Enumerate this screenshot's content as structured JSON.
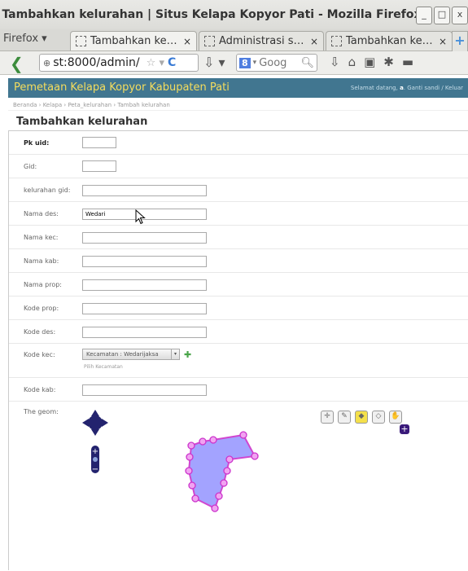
{
  "window": {
    "title": "Tambahkan kelurahan | Situs Kelapa Kopyor Pati - Mozilla Firefox",
    "buttons": [
      "_",
      "□",
      "x"
    ]
  },
  "tabbar": {
    "menu_label": "Firefox ▾",
    "tabs": [
      {
        "label": "Tambahkan ke…",
        "active": true
      },
      {
        "label": "Administrasi s…",
        "active": false
      },
      {
        "label": "Tambahkan ke…",
        "active": false
      }
    ],
    "close_glyph": "×",
    "new_tab_glyph": "+"
  },
  "navbar": {
    "back_glyph": "❮",
    "url_prefix": "st:8000/admin/",
    "search_engine": "8",
    "search_placeholder": "Goog",
    "search_icon": "magnifier-icon",
    "toolbar_icons": [
      "download-arrow-icon",
      "home-icon",
      "addon-icon",
      "bug-icon",
      "folder-icon"
    ]
  },
  "header": {
    "brand": "Pemetaan Kelapa Kopyor Kabupaten Pati",
    "welcome": "Selamat datang, ",
    "username": "a",
    "links": ". Ganti sandi / Keluar"
  },
  "breadcrumbs": "Beranda › Kelapa › Peta_kelurahan › Tambah kelurahan",
  "page_title": "Tambahkan kelurahan",
  "form": {
    "fields": [
      {
        "label": "Pk uid:",
        "value": "",
        "required": true
      },
      {
        "label": "Gid:",
        "value": ""
      },
      {
        "label": "kelurahan gid:",
        "value": ""
      },
      {
        "label": "Nama des:",
        "value": "Wedari"
      },
      {
        "label": "Nama kec:",
        "value": ""
      },
      {
        "label": "Nama kab:",
        "value": ""
      },
      {
        "label": "Nama prop:",
        "value": ""
      },
      {
        "label": "Kode prop:",
        "value": ""
      },
      {
        "label": "Kode des:",
        "value": ""
      },
      {
        "label": "Kode kec:",
        "select_value": "Kecamatan : Wedarijaksa",
        "help": "Pilih Kecamatan"
      },
      {
        "label": "Kode kab:",
        "value": ""
      },
      {
        "label": "The geom:"
      }
    ]
  },
  "map": {
    "tools": [
      "pan-icon",
      "draw-point-icon",
      "draw-polygon-icon",
      "modify-icon",
      "hand-icon"
    ],
    "accent": "#cc33cc",
    "polygon_fill": "#9a9aff"
  },
  "colors": {
    "header_bg": "#417690",
    "brand_text": "#f5dd5d"
  }
}
